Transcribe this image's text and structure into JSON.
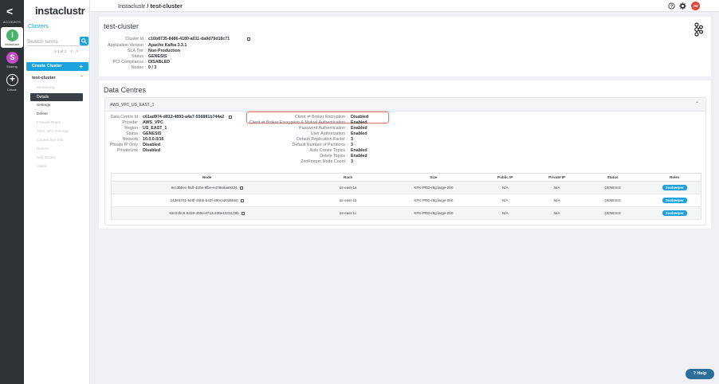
{
  "rail": {
    "back_glyph": "<",
    "section_label": "ACCOUNTS",
    "items": [
      {
        "initial": "I",
        "label": "Instaclustr",
        "color": "#49b36a"
      },
      {
        "initial": "S",
        "label": "Sharing",
        "color": "#c14fc4"
      },
      {
        "initial": "+",
        "label": "Create"
      }
    ]
  },
  "sidebar": {
    "logo": "instaclustr",
    "title": "Clusters",
    "search_placeholder": "Search terms",
    "pager": "1-1 of 1",
    "create_label": "Create Cluster",
    "cluster_name": "test-cluster",
    "menu": [
      {
        "label": "Monitoring",
        "enabled": false
      },
      {
        "label": "Details",
        "enabled": true,
        "active": true
      },
      {
        "label": "Settings",
        "enabled": true
      },
      {
        "label": "Delete",
        "enabled": true
      },
      {
        "label": "Firewall Rules",
        "enabled": false
      },
      {
        "label": "AWS VPC Peering",
        "enabled": false
      },
      {
        "label": "Connection Info",
        "enabled": false
      },
      {
        "label": "Resize",
        "enabled": false
      },
      {
        "label": "Add Nodes",
        "enabled": false
      },
      {
        "label": "Users",
        "enabled": false
      }
    ]
  },
  "topbar": {
    "crumb_root": "Instaclustr",
    "crumb_sep": " / ",
    "crumb_current": "test-cluster",
    "help_icon": "question-circle-icon",
    "settings_icon": "gear-icon",
    "user_initials": "JW"
  },
  "cluster": {
    "title": "test-cluster",
    "fields": [
      {
        "label": "Cluster Id :",
        "value": "c16b8735-8486-4180-a011-da9d79d18c71",
        "copy": true
      },
      {
        "label": "Application Version :",
        "value": "Apache Kafka 3.3.1"
      },
      {
        "label": "SLA Tier :",
        "value": "Non-Production"
      },
      {
        "label": "Status :",
        "value": "GENESIS"
      },
      {
        "label": "PCI Compliance :",
        "value": "DISABLED"
      },
      {
        "label": "Nodes :",
        "value": "0 / 3"
      }
    ]
  },
  "data_centres": {
    "title": "Data Centres",
    "name": "AWS_VPC_US_EAST_1",
    "left_fields": [
      {
        "label": "Data Centre Id :",
        "value": "c61ad974-d812-4893-a4a7-556881b744a2",
        "copy": true
      },
      {
        "label": "Provider :",
        "value": "AWS_VPC"
      },
      {
        "label": "Region :",
        "value": "US_EAST_1"
      },
      {
        "label": "Status :",
        "value": "GENESIS"
      },
      {
        "label": "Network :",
        "value": "10.0.0.0/16"
      },
      {
        "label": "Private IP Only :",
        "value": "Disabled"
      },
      {
        "label": "PrivateLink :",
        "value": "Disabled"
      }
    ],
    "right_fields": [
      {
        "label": "Client ⇌ Broker Encryption :",
        "value": "Disabled"
      },
      {
        "label": "Client ⇌ Broker Encryption & Mutual Authentication :",
        "value": "Enabled"
      },
      {
        "label": "Password Authentication :",
        "value": "Enabled"
      },
      {
        "label": "User Authorization :",
        "value": "Enabled"
      },
      {
        "label": "Default Replication Factor :",
        "value": "3"
      },
      {
        "label": "Default Number of Partitions :",
        "value": "3"
      },
      {
        "label": "Auto Create Topics :",
        "value": "Enabled"
      },
      {
        "label": "Delete Topics :",
        "value": "Enabled"
      },
      {
        "label": "ZooKeeper Node Count :",
        "value": "3"
      }
    ],
    "table": {
      "headers": [
        "Node",
        "Rack",
        "Size",
        "Public IP",
        "Private IP",
        "Status",
        "Roles"
      ],
      "rows": [
        {
          "node": "8cc3bbec-f6df-410a-9fbe-e47666aa5324",
          "rack": "us-east-1a",
          "size": "KFK-PRD-r6g.large-250",
          "public_ip": "N/A",
          "private_ip": "N/A",
          "status": "GENESIS",
          "role": "Zookeeper"
        },
        {
          "node": "24383701-5e5f-45bb-b42f-490ca23d5b50",
          "rack": "us-east-1b",
          "size": "KFK-PRD-r6g.large-250",
          "public_ip": "N/A",
          "private_ip": "N/A",
          "status": "GENESIS",
          "role": "Zookeeper"
        },
        {
          "node": "63c02bc8-9439-400e-8713-230e1033179b",
          "rack": "us-east-1c",
          "size": "KFK-PRD-r6g.large-250",
          "public_ip": "N/A",
          "private_ip": "N/A",
          "status": "GENESIS",
          "role": "Zookeeper"
        }
      ]
    }
  },
  "help_label": "Help",
  "colors": {
    "accent": "#1aa3de",
    "highlight": "#e27a73",
    "help": "#2d6d99"
  }
}
